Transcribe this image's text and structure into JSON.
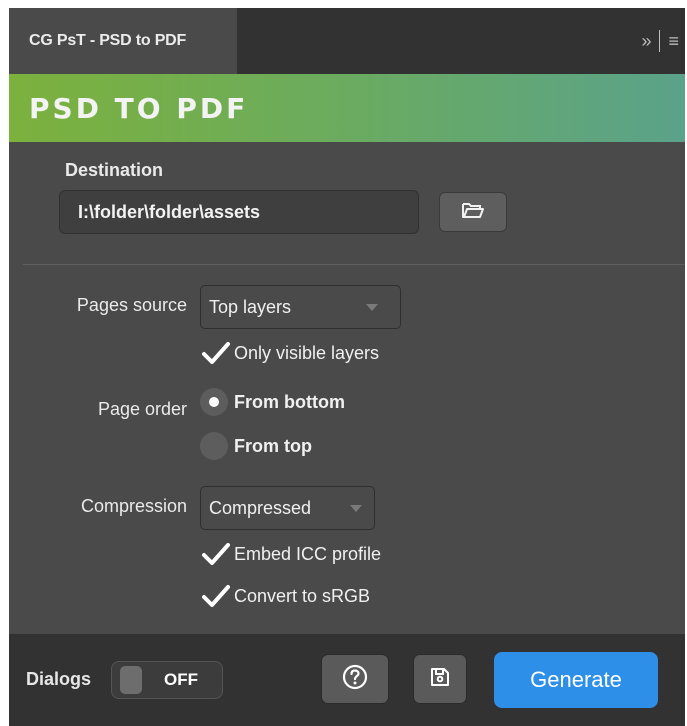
{
  "tab": {
    "title": "CG PsT - PSD to PDF",
    "expand_glyph": "»",
    "menu_glyph": "≡"
  },
  "header": {
    "title": "PSD TO PDF"
  },
  "destination": {
    "label": "Destination",
    "path": "I:\\folder\\folder\\assets",
    "browse_icon": "folder-open-icon"
  },
  "pages_source": {
    "label": "Pages source",
    "selected": "Top layers",
    "only_visible_label": "Only visible layers",
    "only_visible_checked": true
  },
  "page_order": {
    "label": "Page order",
    "options": [
      {
        "label": "From bottom",
        "selected": true
      },
      {
        "label": "From top",
        "selected": false
      }
    ]
  },
  "compression": {
    "label": "Compression",
    "selected": "Compressed",
    "embed_icc_label": "Embed ICC profile",
    "embed_icc_checked": true,
    "convert_srgb_label": "Convert to sRGB",
    "convert_srgb_checked": true
  },
  "footer": {
    "dialogs_label": "Dialogs",
    "dialogs_state": "OFF",
    "help_icon": "help-icon",
    "save_icon": "save-icon",
    "generate_label": "Generate"
  },
  "colors": {
    "accent": "#2d8fe8",
    "header_start": "#7cb13d",
    "header_end": "#5aa28a"
  }
}
